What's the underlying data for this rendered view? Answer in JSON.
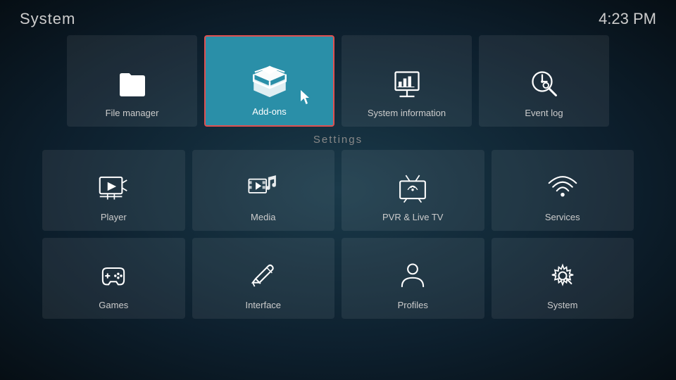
{
  "header": {
    "title": "System",
    "time": "4:23 PM"
  },
  "top_tiles": [
    {
      "id": "file-manager",
      "label": "File manager",
      "active": false
    },
    {
      "id": "add-ons",
      "label": "Add-ons",
      "active": true
    },
    {
      "id": "system-information",
      "label": "System information",
      "active": false
    },
    {
      "id": "event-log",
      "label": "Event log",
      "active": false
    }
  ],
  "settings_label": "Settings",
  "settings_tiles": [
    {
      "id": "player",
      "label": "Player"
    },
    {
      "id": "media",
      "label": "Media"
    },
    {
      "id": "pvr-live-tv",
      "label": "PVR & Live TV"
    },
    {
      "id": "services",
      "label": "Services"
    },
    {
      "id": "games",
      "label": "Games"
    },
    {
      "id": "interface",
      "label": "Interface"
    },
    {
      "id": "profiles",
      "label": "Profiles"
    },
    {
      "id": "system",
      "label": "System"
    }
  ]
}
